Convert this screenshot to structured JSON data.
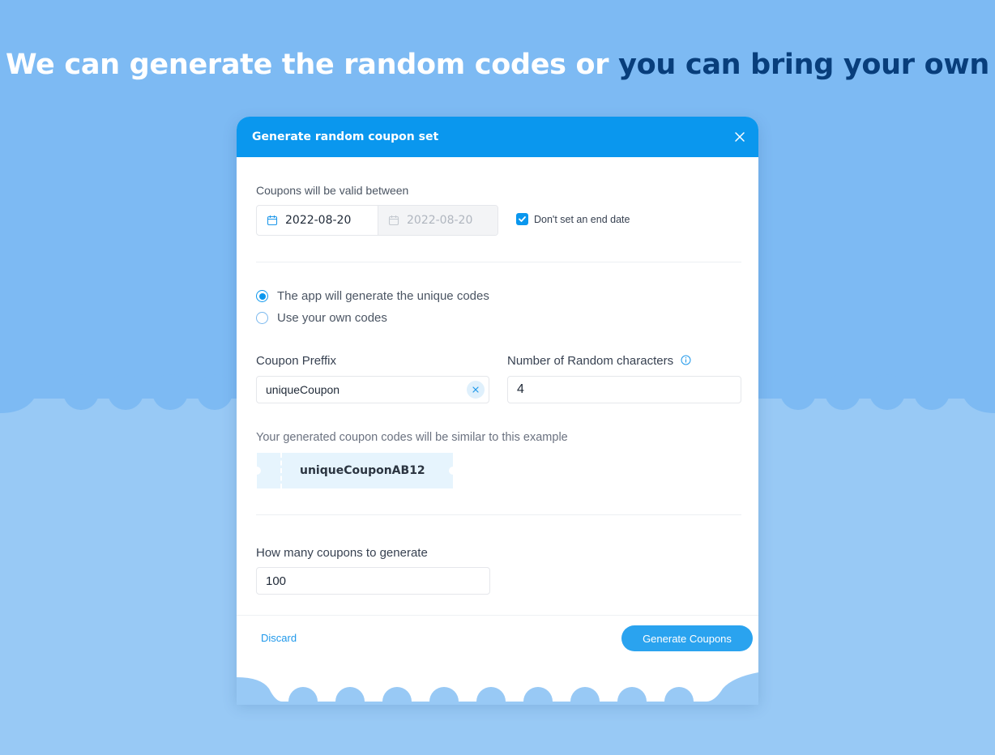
{
  "page": {
    "headline_part1": "We can generate the random codes or",
    "headline_part2": "you can bring your own"
  },
  "colors": {
    "background_top": "#7dbaf3",
    "background_bottom": "#98c9f5",
    "accent": "#0a97ee",
    "headline_highlight": "#083e7b"
  },
  "modal": {
    "title": "Generate random coupon set",
    "close_icon": "close-icon",
    "validity": {
      "label": "Coupons will be valid between",
      "start_date": "2022-08-20",
      "end_date": "2022-08-20",
      "no_end_date_label": "Don't set an end date",
      "no_end_date_checked": true
    },
    "code_source": {
      "options": [
        {
          "label": "The app will generate the unique codes",
          "selected": true
        },
        {
          "label": "Use your own codes",
          "selected": false
        }
      ]
    },
    "prefix": {
      "label": "Coupon Preffix",
      "value": "uniqueCoupon"
    },
    "random_chars": {
      "label": "Number of Random characters",
      "value": "4"
    },
    "example": {
      "label": "Your generated coupon codes will be similar to this example",
      "code": "uniqueCouponAB12"
    },
    "quantity": {
      "label": "How many coupons to generate",
      "value": "100"
    },
    "footer": {
      "discard_label": "Discard",
      "generate_label": "Generate Coupons"
    }
  }
}
